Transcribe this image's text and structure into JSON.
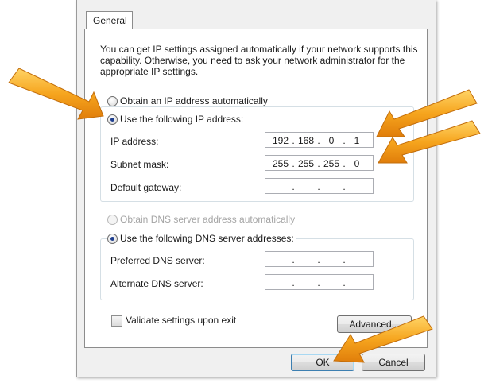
{
  "tab": {
    "label": "General"
  },
  "description": "You can get IP settings assigned automatically if your network supports this capability. Otherwise, you need to ask your network administrator for the appropriate IP settings.",
  "ip": {
    "auto_label": "Obtain an IP address automatically",
    "manual_label": "Use the following IP address:",
    "selected": "manual",
    "fields": [
      {
        "label": "IP address:",
        "octets": [
          "192",
          "168",
          "0",
          "1"
        ]
      },
      {
        "label": "Subnet mask:",
        "octets": [
          "255",
          "255",
          "255",
          "0"
        ]
      },
      {
        "label": "Default gateway:",
        "octets": [
          "",
          "",
          "",
          ""
        ]
      }
    ]
  },
  "dns": {
    "auto_label": "Obtain DNS server address automatically",
    "manual_label": "Use the following DNS server addresses:",
    "selected": "manual",
    "fields": [
      {
        "label": "Preferred DNS server:",
        "octets": [
          "",
          "",
          "",
          ""
        ]
      },
      {
        "label": "Alternate DNS server:",
        "octets": [
          "",
          "",
          "",
          ""
        ]
      }
    ]
  },
  "validate": {
    "label": "Validate settings upon exit",
    "checked": false
  },
  "buttons": {
    "advanced": "Advanced...",
    "ok": "OK",
    "cancel": "Cancel"
  },
  "colors": {
    "arrow": "#f2a01a",
    "group_border": "#d5dfe5",
    "radio_dot": "#1f3f8f"
  }
}
